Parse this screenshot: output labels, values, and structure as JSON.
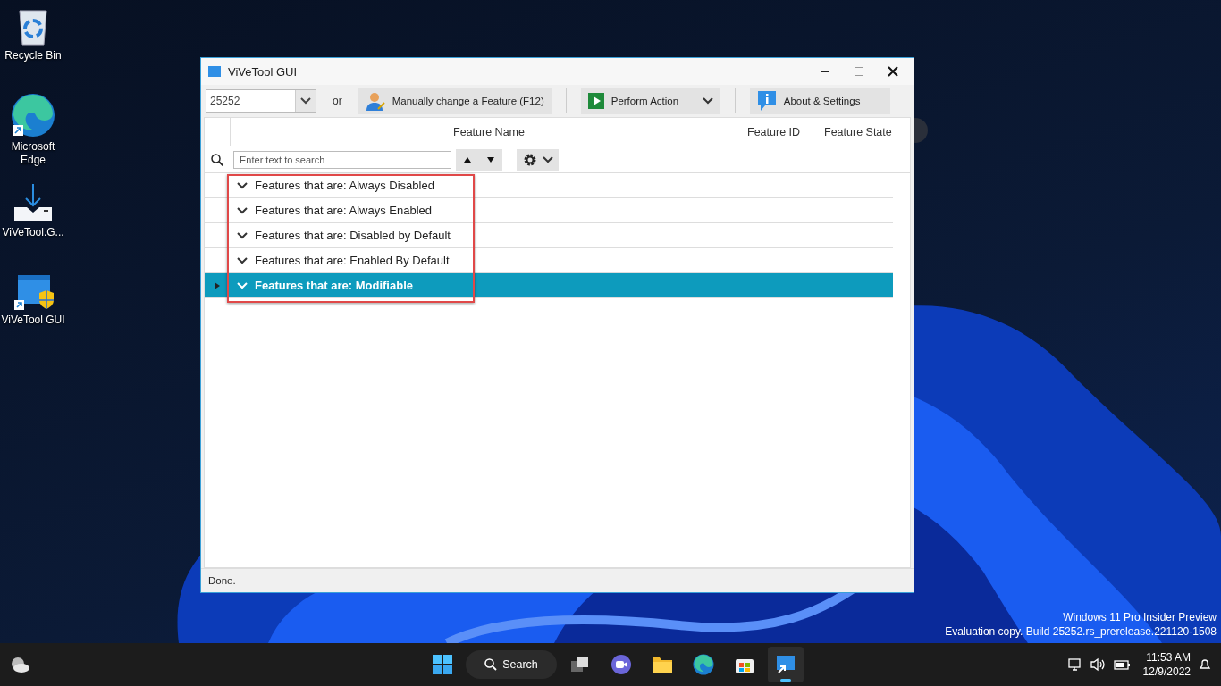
{
  "desktop_icons": [
    {
      "kind": "recycle",
      "label": "Recycle Bin"
    },
    {
      "kind": "edge",
      "label": "Microsoft Edge"
    },
    {
      "kind": "download",
      "label": "ViVeTool.G..."
    },
    {
      "kind": "vivetool",
      "label": "ViVeTool GUI"
    }
  ],
  "window": {
    "title": "ViVeTool GUI",
    "build_combo": {
      "value": "25252"
    },
    "or_label": "or",
    "buttons": [
      {
        "kind": "manual",
        "label": "Manually change a Feature (F12)"
      },
      {
        "kind": "perform",
        "label": "Perform Action"
      },
      {
        "kind": "about",
        "label": "About & Settings"
      }
    ],
    "columns": [
      "Feature Name",
      "Feature ID",
      "Feature State"
    ],
    "search": {
      "placeholder": "Enter text to search"
    },
    "groups": [
      {
        "label": "Features that are: Always Disabled",
        "expanded": true,
        "selected": false
      },
      {
        "label": "Features that are: Always Enabled",
        "expanded": true,
        "selected": false
      },
      {
        "label": "Features that are: Disabled by Default",
        "expanded": true,
        "selected": false
      },
      {
        "label": "Features that are: Enabled By Default",
        "expanded": true,
        "selected": false
      },
      {
        "label": "Features that are: Modifiable",
        "expanded": true,
        "selected": true
      }
    ],
    "status": "Done."
  },
  "watermark": {
    "line_1": "Windows 11 Pro Insider Preview",
    "line_2": "Evaluation copy. Build 25252.rs_prerelease.221120-1508"
  },
  "taskbar": {
    "search_label": "Search",
    "apps": [
      {
        "kind": "taskview",
        "selected": false
      },
      {
        "kind": "chat",
        "selected": false
      },
      {
        "kind": "folder",
        "selected": false
      },
      {
        "kind": "edge",
        "selected": false
      },
      {
        "kind": "store",
        "selected": false
      },
      {
        "kind": "vivetool",
        "selected": true
      }
    ],
    "time": "11:53 AM",
    "date": "12/9/2022"
  }
}
